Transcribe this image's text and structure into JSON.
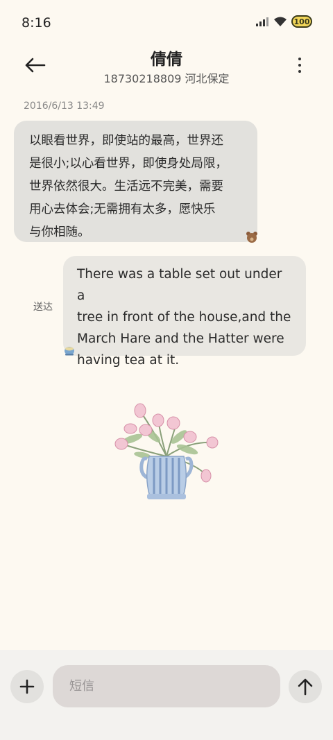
{
  "status_bar": {
    "time": "8:16",
    "battery": "100",
    "icons": [
      "signal-icon",
      "wifi-icon",
      "battery-icon"
    ]
  },
  "header": {
    "title": "倩倩",
    "subtitle": "18730218809 河北保定",
    "back_icon": "back-arrow-icon",
    "more_icon": "more-vert-icon"
  },
  "messages": [
    {
      "direction": "incoming",
      "timestamp": "2016/6/13 13:49",
      "lines": [
        "以眼看世界，即使站的最高，世界还",
        "是很小;以心看世界，即使身处局限，",
        "世界依然很大。生活远不完美，需要",
        "用心去体会;无需拥有太多，愿快乐",
        "与你相随。"
      ]
    },
    {
      "direction": "outgoing",
      "status": "送达",
      "lines": [
        "There was a table set out under a",
        "tree in front of the house,and the",
        "March Hare and the Hatter were",
        "having tea at it."
      ]
    }
  ],
  "composer": {
    "placeholder": "短信",
    "add_icon": "plus-icon",
    "send_icon": "send-arrow-icon"
  },
  "colors": {
    "background": "#fdf9f1",
    "incoming_bubble": "#e2e1dd",
    "outgoing_bubble": "#e9e7e2",
    "input_bg": "#ddd8d6",
    "battery": "#f2d659"
  }
}
